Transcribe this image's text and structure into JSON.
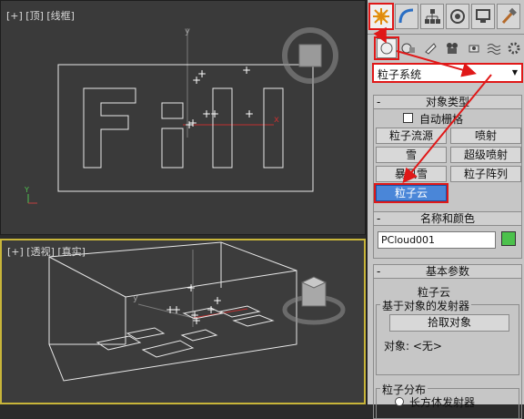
{
  "viewports": {
    "top": {
      "label": "[+] [顶] [线框]",
      "text_on_plane": "Fill"
    },
    "perspective": {
      "label": "[+] [透视] [真实]"
    }
  },
  "command_panel": {
    "tabs": [
      "create-tab",
      "modify-tab",
      "hierarchy-tab",
      "motion-tab",
      "display-tab",
      "utilities-tab"
    ],
    "category_dropdown": "粒子系统",
    "object_type": {
      "title": "对象类型",
      "autogrid_label": "自动栅格",
      "buttons": [
        "粒子流源",
        "喷射",
        "雪",
        "超级喷射",
        "暴风雪",
        "粒子阵列",
        "粒子云"
      ],
      "selected": "粒子云"
    },
    "name_color": {
      "title": "名称和颜色",
      "name_value": "PCloud001",
      "color": "#4cc14c"
    },
    "basic_params": {
      "title": "基本参数",
      "subtitle": "粒子云",
      "emitter_group_label": "基于对象的发射器",
      "pick_button": "拾取对象",
      "object_label": "对象: <无>",
      "distribution_label": "粒子分布",
      "box_emitter_label": "长方体发射器"
    }
  },
  "colors": {
    "highlight": "#e01818",
    "selected_button": "#4a86d8",
    "viewport_active": "#c8b53a"
  }
}
